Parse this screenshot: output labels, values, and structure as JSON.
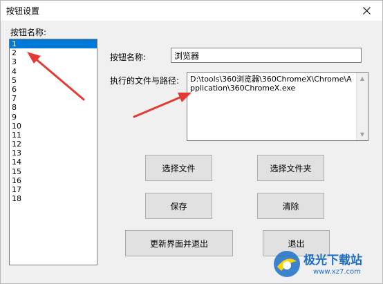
{
  "window": {
    "title": "按钮设置"
  },
  "list": {
    "label": "按钮名称:",
    "items": [
      "1",
      "2",
      "3",
      "4",
      "5",
      "6",
      "7",
      "8",
      "9",
      "10",
      "11",
      "12",
      "13",
      "14",
      "15",
      "16",
      "17",
      "18"
    ],
    "selected": "1"
  },
  "form": {
    "name_label": "按钮名称:",
    "name_value": "浏览器",
    "path_label": "执行的文件与路径:",
    "path_value": "D:\\tools\\360浏览器\\360ChromeX\\Chrome\\Application\\360ChromeX.exe"
  },
  "buttons": {
    "select_file": "选择文件",
    "select_folder": "选择文件夹",
    "save": "保存",
    "clear": "清除",
    "update_exit": "更新界面并退出",
    "exit": "退出"
  },
  "watermark": {
    "name": "极光下载站",
    "url": "www.xz7.com"
  },
  "colors": {
    "selection": "#0078d7",
    "annotation": "#e53a33",
    "watermark": "#1d6ec7"
  },
  "icons": {
    "close": "close-icon",
    "scroll_up": "scroll-up-icon",
    "scroll_down": "scroll-down-icon"
  }
}
